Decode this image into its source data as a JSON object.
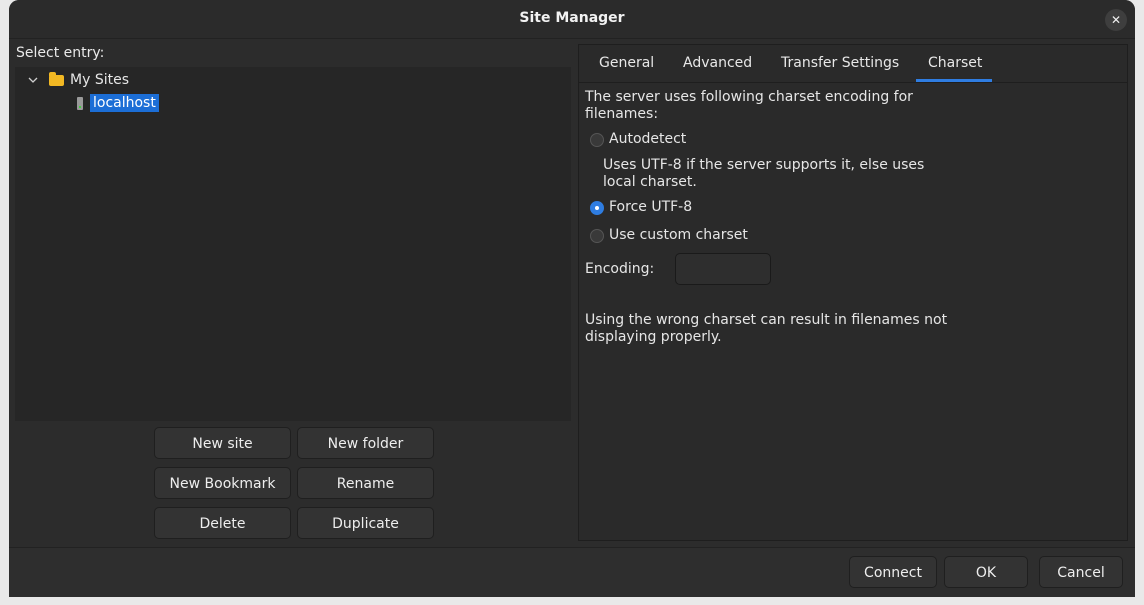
{
  "window": {
    "title": "Site Manager",
    "close_glyph": "✕"
  },
  "left": {
    "select_label": "Select entry:",
    "tree": {
      "folder_label": "My Sites",
      "site_label": "localhost"
    },
    "buttons": {
      "new_site": "New site",
      "new_folder": "New folder",
      "new_bookmark": "New Bookmark",
      "rename": "Rename",
      "delete": "Delete",
      "duplicate": "Duplicate"
    }
  },
  "tabs": {
    "general": "General",
    "advanced": "Advanced",
    "transfer": "Transfer Settings",
    "charset": "Charset",
    "active": "Charset"
  },
  "charset": {
    "intro_line1": "The server uses following charset encoding for",
    "intro_line2": "filenames:",
    "autodetect": "Autodetect",
    "autodetect_desc_line1": "Uses UTF-8 if the server supports it, else uses",
    "autodetect_desc_line2": "local charset.",
    "force_utf8": "Force UTF-8",
    "custom": "Use custom charset",
    "selected": "Force UTF-8",
    "encoding_label": "Encoding:",
    "encoding_value": "",
    "warning_line1": "Using the wrong charset can result in filenames not",
    "warning_line2": "displaying properly."
  },
  "footer": {
    "connect": "Connect",
    "ok": "OK",
    "cancel": "Cancel"
  },
  "colors": {
    "accent": "#2f7de1",
    "selection": "#1c6ed6",
    "folder": "#f2b823"
  }
}
